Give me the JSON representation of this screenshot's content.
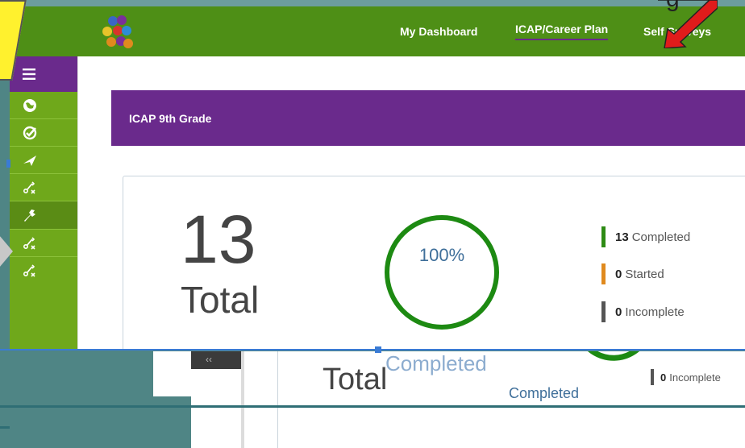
{
  "nav": {
    "dashboard": "My Dashboard",
    "icap": "ICAP/Career Plan",
    "self_surveys": "Self Surveys"
  },
  "banner": {
    "title": "ICAP 9th Grade"
  },
  "summary": {
    "total_count": "13",
    "total_label": "Total",
    "percent": "100%",
    "completed_label": "Completed"
  },
  "legend": [
    {
      "count": "13",
      "label": "Completed",
      "color": "#2e8b14"
    },
    {
      "count": "0",
      "label": "Started",
      "color": "#e08a1e"
    },
    {
      "count": "0",
      "label": "Incomplete",
      "color": "#555555"
    }
  ],
  "sidebar_icons": [
    "menu-icon",
    "globe-icon",
    "check-badge-icon",
    "paper-plane-icon",
    "strategy-icon",
    "wrench-icon",
    "strategy-icon",
    "strategy-icon"
  ],
  "colors": {
    "brand_green": "#4e8f16",
    "sidebar_green": "#6fa81b",
    "purple": "#6a2a8c",
    "ring_green": "#1d8a12"
  },
  "callout": {
    "letter": "g"
  }
}
